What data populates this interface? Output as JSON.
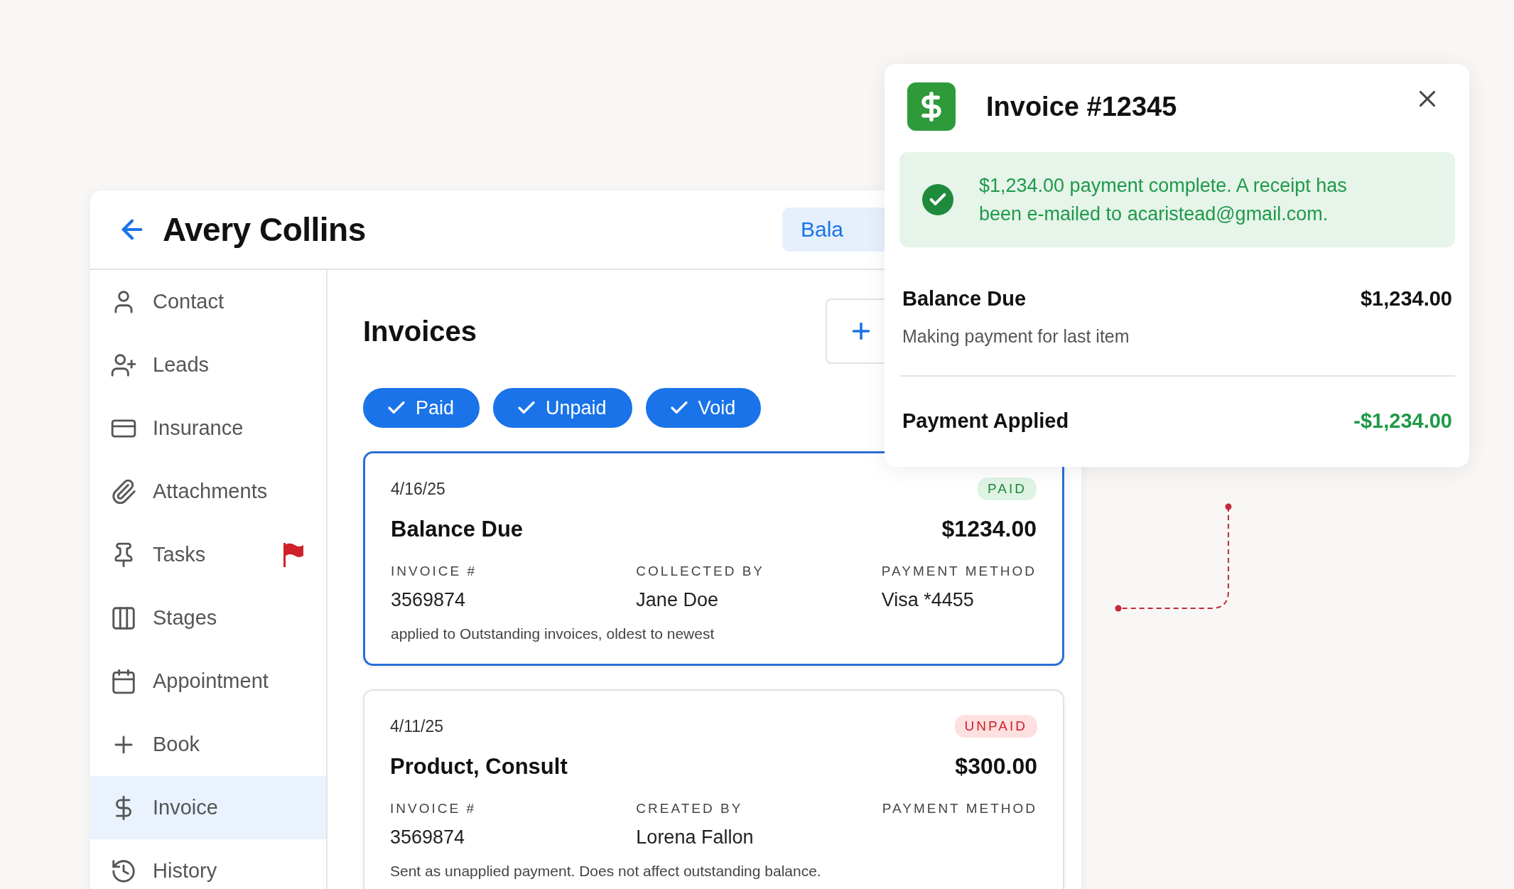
{
  "header": {
    "title": "Avery Collins",
    "balance_button": "Bala"
  },
  "sidebar": {
    "items": [
      {
        "label": "Contact",
        "selected": false,
        "flagged": false
      },
      {
        "label": "Leads",
        "selected": false,
        "flagged": false
      },
      {
        "label": "Insurance",
        "selected": false,
        "flagged": false
      },
      {
        "label": "Attachments",
        "selected": false,
        "flagged": false
      },
      {
        "label": "Tasks",
        "selected": false,
        "flagged": true
      },
      {
        "label": "Stages",
        "selected": false,
        "flagged": false
      },
      {
        "label": "Appointment",
        "selected": false,
        "flagged": false
      },
      {
        "label": "Book",
        "selected": false,
        "flagged": false
      },
      {
        "label": "Invoice",
        "selected": true,
        "flagged": false
      },
      {
        "label": "History",
        "selected": false,
        "flagged": false
      }
    ]
  },
  "content": {
    "title": "Invoices",
    "filters": [
      {
        "label": "Paid",
        "checked": true
      },
      {
        "label": "Unpaid",
        "checked": true
      },
      {
        "label": "Void",
        "checked": true
      }
    ],
    "invoices": [
      {
        "date": "4/16/25",
        "status": "PAID",
        "kind": "paid",
        "selected": true,
        "title": "Balance Due",
        "amount": "$1234.00",
        "fields": [
          {
            "label": "INVOICE #",
            "value": "3569874"
          },
          {
            "label": "COLLECTED BY",
            "value": "Jane Doe"
          },
          {
            "label": "PAYMENT METHOD",
            "value": "Visa *4455"
          }
        ],
        "note": "applied to Outstanding invoices, oldest to newest"
      },
      {
        "date": "4/11/25",
        "status": "UNPAID",
        "kind": "unpaid",
        "selected": false,
        "title": "Product, Consult",
        "amount": "$300.00",
        "fields": [
          {
            "label": "INVOICE #",
            "value": "3569874"
          },
          {
            "label": "CREATED BY",
            "value": "Lorena Fallon"
          },
          {
            "label": "PAYMENT METHOD"
          }
        ],
        "note": "Sent as unapplied payment. Does not affect outstanding balance."
      }
    ]
  },
  "popup": {
    "title": "Invoice #12345",
    "message": "$1,234.00 payment complete. A receipt has been e-mailed to acaristead@gmail.com.",
    "rows": [
      {
        "label": "Balance Due",
        "amount": "$1,234.00",
        "kind": "due",
        "note": "Making payment for last item"
      },
      {
        "label": "Payment Applied",
        "amount": "-$1,234.00",
        "kind": "credit"
      }
    ]
  }
}
